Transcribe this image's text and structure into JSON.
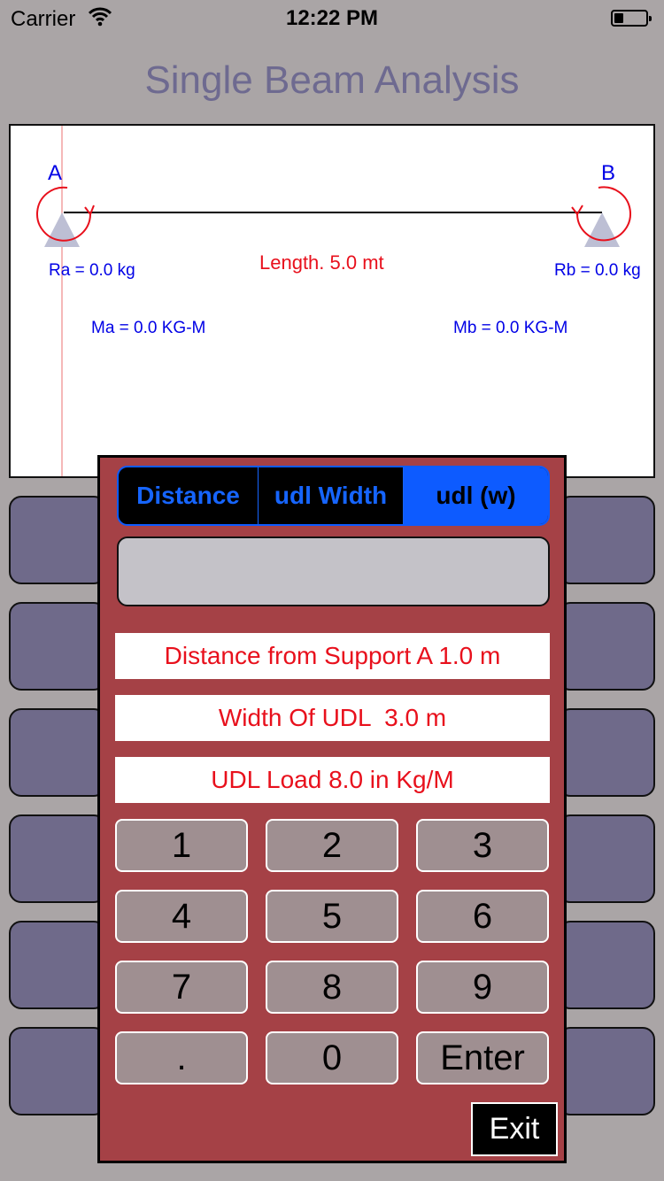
{
  "status_bar": {
    "carrier": "Carrier",
    "time": "12:22 PM",
    "battery_level": 0.3
  },
  "header": {
    "title": "Single Beam Analysis"
  },
  "diagram": {
    "support_a": "A",
    "support_b": "B",
    "ra": "Ra = 0.0 kg",
    "rb": "Rb = 0.0 kg",
    "length": "Length. 5.0 mt",
    "ma": "Ma = 0.0 KG-M",
    "mb": "Mb = 0.0 KG-M",
    "colors": {
      "labels": "#0000e6",
      "moments": "#e8101c",
      "supports": "#bdbfd4"
    }
  },
  "dialog": {
    "tabs": [
      "Distance",
      "udl Width",
      "udl (w)"
    ],
    "selected_tab": "udl (w)",
    "input_value": "",
    "info_distance": "Distance from Support A 1.0 m",
    "info_width": "Width Of UDL  3.0 m",
    "info_load": "UDL Load 8.0 in Kg/M",
    "keys": [
      "1",
      "2",
      "3",
      "4",
      "5",
      "6",
      "7",
      "8",
      "9",
      ".",
      "0",
      "Enter"
    ],
    "exit_label": "Exit",
    "colors": {
      "panel": "#a54146",
      "accent": "#0d5bff",
      "info_text": "#e8101c"
    }
  }
}
